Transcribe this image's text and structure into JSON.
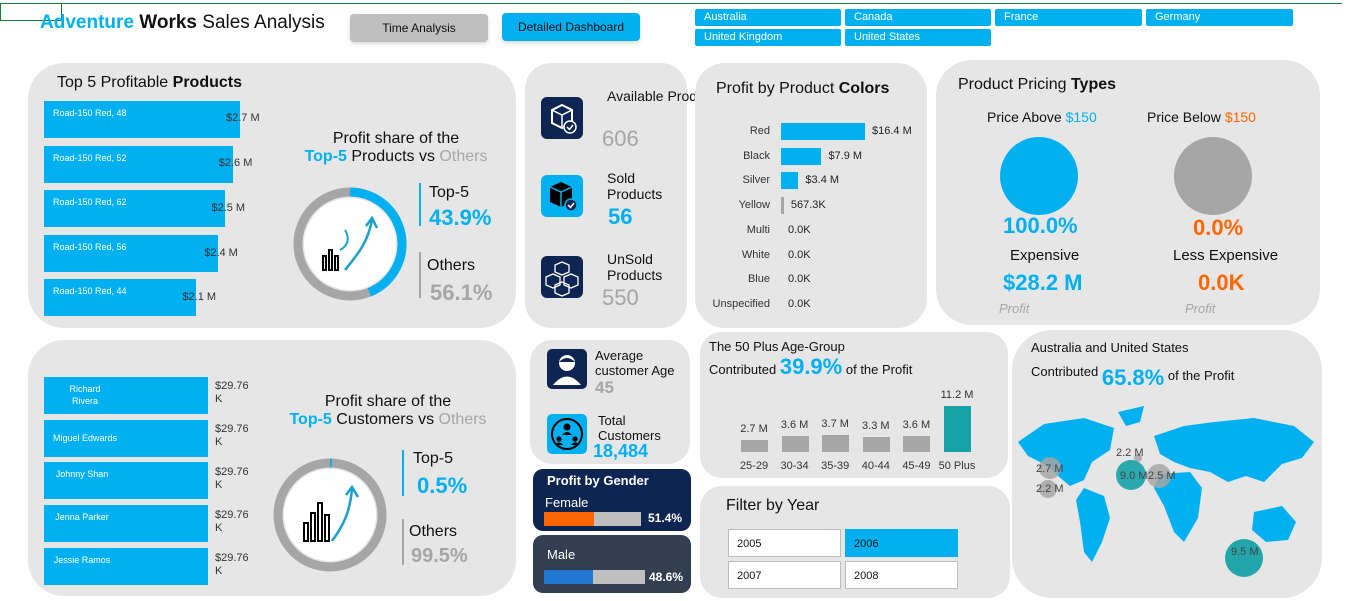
{
  "header": {
    "title_part1": "Adventure",
    "title_part2": "Works",
    "title_part3": "Sales Analysis",
    "btn_time": "Time Analysis",
    "btn_detailed": "Detailed Dashboard",
    "countries": [
      "Australia",
      "Canada",
      "France",
      "Germany",
      "United Kingdom",
      "United States"
    ]
  },
  "top_products": {
    "title_part1": "Top 5 Profitable",
    "title_part2": "Products",
    "items": [
      {
        "name": "Road-150 Red, 48",
        "value": "$2.7 M",
        "amount": 2.7
      },
      {
        "name": "Road-150 Red, 52",
        "value": "$2.6 M",
        "amount": 2.6
      },
      {
        "name": "Road-150 Red, 62",
        "value": "$2.5 M",
        "amount": 2.5
      },
      {
        "name": "Road-150 Red, 56",
        "value": "$2.4 M",
        "amount": 2.4
      },
      {
        "name": "Road-150 Red, 44",
        "value": "$2.1 M",
        "amount": 2.1
      }
    ],
    "share_line1": "Profit share of the",
    "share_top5": "Top-5",
    "share_mid": "Products vs",
    "share_others": "Others",
    "top5_label": "Top-5",
    "top5_value": "43.9%",
    "others_label": "Others",
    "others_value": "56.1%",
    "top5_fraction": 0.439
  },
  "top_customers": {
    "items": [
      {
        "name": "Richard Rivera",
        "value": "$29.76 K",
        "amount": 29.76
      },
      {
        "name": "Miguel Edwards",
        "value": "$29.76 K",
        "amount": 29.76
      },
      {
        "name": "Johnny Shan",
        "value": "$29.76 K",
        "amount": 29.76
      },
      {
        "name": "Jenna Parker",
        "value": "$29.76 K",
        "amount": 29.76
      },
      {
        "name": "Jessie Ramos",
        "value": "$29.76 K",
        "amount": 29.76
      }
    ],
    "share_line1": "Profit share of the",
    "share_top5": "Top-5",
    "share_mid": "Customers vs",
    "share_others": "Others",
    "top5_label": "Top-5",
    "top5_value": "0.5%",
    "others_label": "Others",
    "others_value": "99.5%",
    "top5_fraction": 0.005
  },
  "products_kpi": {
    "available_label": "Available Products",
    "available_value": "606",
    "sold_label": "Sold Products",
    "sold_value": "56",
    "unsold_label": "UnSold Products",
    "unsold_value": "550"
  },
  "colors_chart": {
    "title_part1": "Profit by Product",
    "title_part2": "Colors",
    "items": [
      {
        "label": "Red",
        "value": "$16.4 M",
        "amount": 16.4
      },
      {
        "label": "Black",
        "value": "$7.9 M",
        "amount": 7.9
      },
      {
        "label": "Silver",
        "value": "$3.4 M",
        "amount": 3.4
      },
      {
        "label": "Yellow",
        "value": "567.3K",
        "amount": 0.5673
      },
      {
        "label": "Multi",
        "value": "0.0K",
        "amount": 0
      },
      {
        "label": "White",
        "value": "0.0K",
        "amount": 0
      },
      {
        "label": "Blue",
        "value": "0.0K",
        "amount": 0
      },
      {
        "label": "Unspecified",
        "value": "0.0K",
        "amount": 0
      }
    ]
  },
  "pricing": {
    "title_part1": "Product Pricing",
    "title_part2": "Types",
    "above_label": "Price Above",
    "above_amount": "$150",
    "below_label": "Price Below",
    "below_amount": "$150",
    "above_pct": "100.0%",
    "below_pct": "0.0%",
    "above_type": "Expensive",
    "below_type": "Less Expensive",
    "above_profit": "$28.2 M",
    "below_profit": "0.0K",
    "profit_label": "Profit"
  },
  "customers_kpi": {
    "avg_age_label": "Average customer Age",
    "avg_age_value": "45",
    "total_label": "Total Customers",
    "total_value": "18,484"
  },
  "gender": {
    "title": "Profit by Gender",
    "female_label": "Female",
    "female_value": "51.4%",
    "female_fraction": 0.514,
    "male_label": "Male",
    "male_value": "48.6%",
    "male_fraction": 0.486
  },
  "age_chart": {
    "line1": "The 50 Plus  Age-Group",
    "line2a": "Contributed",
    "highlight": "39.9%",
    "line2b": "of the Profit",
    "items": [
      {
        "cat": "25-29",
        "label": "2.7 M",
        "amount": 2.7
      },
      {
        "cat": "30-34",
        "label": "3.6 M",
        "amount": 3.6
      },
      {
        "cat": "35-39",
        "label": "3.7 M",
        "amount": 3.7
      },
      {
        "cat": "40-44",
        "label": "3.3 M",
        "amount": 3.3
      },
      {
        "cat": "45-49",
        "label": "3.6 M",
        "amount": 3.6
      },
      {
        "cat": "50 Plus",
        "label": "11.2 M",
        "amount": 11.2
      }
    ]
  },
  "map_panel": {
    "line1": "Australia and  United States",
    "line2a": "Contributed",
    "highlight": "65.8%",
    "line2b": "of the Profit",
    "bubbles": [
      "2.7 M",
      "2.2 M",
      "2.2 M",
      "9.0 M",
      "2.5 M",
      "9.5 M"
    ]
  },
  "year_filter": {
    "title": "Filter by Year",
    "years": [
      {
        "label": "2005",
        "selected": false
      },
      {
        "label": "2006",
        "selected": true
      },
      {
        "label": "2007",
        "selected": false
      },
      {
        "label": "2008",
        "selected": false
      }
    ]
  },
  "theme": {
    "accent": "#00b0f0",
    "grey": "#a6a6a6",
    "orange": "#ff6600",
    "navy": "#0e2451",
    "teal": "#17a2a8",
    "panel": "#e6e6e6"
  }
}
